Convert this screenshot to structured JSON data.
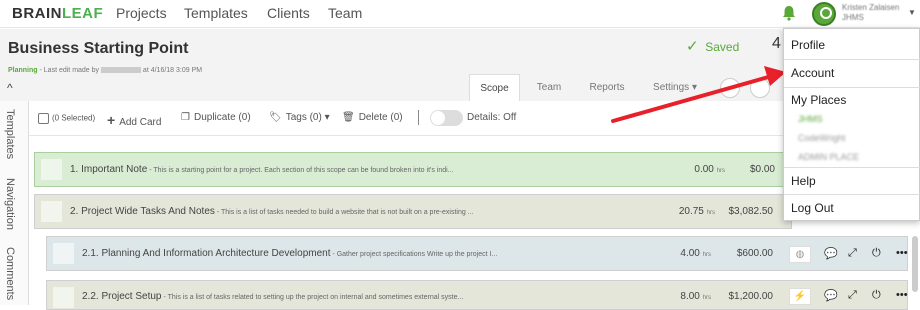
{
  "brand": {
    "part1": "BRAIN",
    "part2": "LEAF"
  },
  "nav": {
    "items": [
      "Projects",
      "Templates",
      "Clients",
      "Team"
    ]
  },
  "user": {
    "name": "Kristen Zalaisen",
    "sub": "JHMS",
    "accent": "#5aa83a"
  },
  "project": {
    "title": "Business Starting Point",
    "status": "Planning",
    "last_edit_prefix": " - Last edit made by ",
    "last_edit_suffix": " at 4/16/18 3:09 PM",
    "saved_label": "Saved",
    "big_number": "4"
  },
  "tabs": [
    "Scope",
    "Team",
    "Reports",
    "Settings ▾"
  ],
  "side": {
    "labels": [
      "Templates",
      "Navigation",
      "Comments"
    ]
  },
  "toolbar": {
    "selected": "(0 Selected)",
    "add_card": "Add Card",
    "duplicate": "Duplicate (0)",
    "tags": "Tags (0) ▾",
    "delete": "Delete (0)",
    "details": "Details: Off"
  },
  "rows": [
    {
      "title": "1. Important Note",
      "desc": " - This is a starting point for a project. Each section of this scope can be found broken into it's indi...",
      "hours": "0.00",
      "cost": "$0.00"
    },
    {
      "title": "2. Project Wide Tasks And Notes",
      "desc": " - This is a list of tasks needed to build a website that is not built on a pre-existing ...",
      "hours": "20.75",
      "cost": "$3,082.50"
    },
    {
      "title": "2.1. Planning And Information Architecture Development",
      "desc": " - Gather project specifications Write up the project I...",
      "hours": "4.00",
      "cost": "$600.00"
    },
    {
      "title": "2.2. Project Setup",
      "desc": " - This is a list of tasks related to setting up the project on internal and sometimes external syste...",
      "hours": "8.00",
      "cost": "$1,200.00"
    }
  ],
  "hrs_unit": "hrs",
  "menu": {
    "profile": "Profile",
    "account": "Account",
    "my_places": "My Places",
    "places": [
      "JHMS",
      "CodeWright",
      "ADMIN PLACE"
    ],
    "help": "Help",
    "logout": "Log Out"
  },
  "colors": {
    "note_row": "#d9ecd4",
    "note_border": "#a9cf9f",
    "group_row": "#e3e6d9",
    "task_row_blue": "#dde6e8",
    "task_row_olive": "#e3e6d9",
    "arrow": "#e8202a"
  }
}
